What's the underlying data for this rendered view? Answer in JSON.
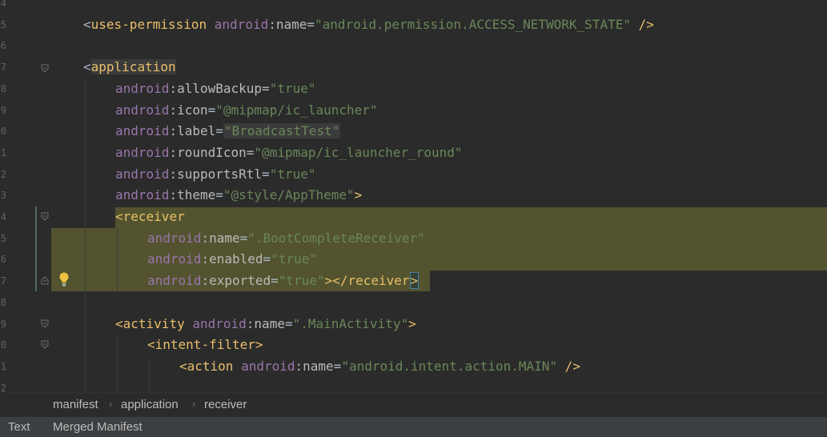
{
  "editor": {
    "line_numbers": [
      "4",
      "5",
      "6",
      "7",
      "8",
      "9",
      "0",
      "1",
      "2",
      "3",
      "4",
      "5",
      "6",
      "7",
      "8",
      "9",
      "0",
      "1",
      "2"
    ],
    "lines": {
      "l5": {
        "open": "<",
        "tag": "uses-permission",
        "attr_ns": "android",
        "colon": ":",
        "attr": "name",
        "eq": "=",
        "value": "\"android.permission.ACCESS_NETWORK_STATE\"",
        "close": " />"
      },
      "l7": {
        "open": "<",
        "tag": "application"
      },
      "l8": {
        "attr_ns": "android",
        "colon": ":",
        "attr": "allowBackup",
        "eq": "=",
        "value": "\"true\""
      },
      "l9": {
        "attr_ns": "android",
        "colon": ":",
        "attr": "icon",
        "eq": "=",
        "value": "\"@mipmap/ic_launcher\""
      },
      "l10": {
        "attr_ns": "android",
        "colon": ":",
        "attr": "label",
        "eq": "=",
        "value": "\"BroadcastTest\""
      },
      "l11": {
        "attr_ns": "android",
        "colon": ":",
        "attr": "roundIcon",
        "eq": "=",
        "value": "\"@mipmap/ic_launcher_round\""
      },
      "l12": {
        "attr_ns": "android",
        "colon": ":",
        "attr": "supportsRtl",
        "eq": "=",
        "value": "\"true\""
      },
      "l13": {
        "attr_ns": "android",
        "colon": ":",
        "attr": "theme",
        "eq": "=",
        "value": "\"@style/AppTheme\"",
        "close": ">"
      },
      "l14": {
        "open": "<",
        "tag": "receiver"
      },
      "l15": {
        "attr_ns": "android",
        "colon": ":",
        "attr": "name",
        "eq": "=",
        "value": "\".BootCompleteReceiver\""
      },
      "l16": {
        "attr_ns": "android",
        "colon": ":",
        "attr": "enabled",
        "eq": "=",
        "value": "\"true\""
      },
      "l17": {
        "attr_ns": "android",
        "colon": ":",
        "attr": "exported",
        "eq": "=",
        "value": "\"true\"",
        "close": "></",
        "end_tag": "receiver",
        "end_close": ">"
      },
      "l19": {
        "open": "<",
        "tag": "activity",
        "attr_ns": "android",
        "colon": ":",
        "attr": "name",
        "eq": "=",
        "value": "\".MainActivity\"",
        "close": ">"
      },
      "l20": {
        "open": "<",
        "tag": "intent-filter",
        "close": ">"
      },
      "l21": {
        "open": "<",
        "tag": "action",
        "attr_ns": "android",
        "colon": ":",
        "attr": "name",
        "eq": "=",
        "value": "\"android.intent.action.MAIN\"",
        "close": " />"
      }
    }
  },
  "breadcrumb": {
    "items": [
      "manifest",
      "application",
      "receiver"
    ],
    "separator": "›"
  },
  "bottom_tabs": {
    "text": "Text",
    "merged": "Merged Manifest"
  },
  "icons": {
    "fold": "fold-marker-icon",
    "bulb": "lightbulb-icon"
  },
  "colors": {
    "background": "#2b2b2b",
    "tag": "#e8bf6a",
    "attr_ns": "#9876aa",
    "string": "#6a8759",
    "highlight": "#53532f"
  }
}
